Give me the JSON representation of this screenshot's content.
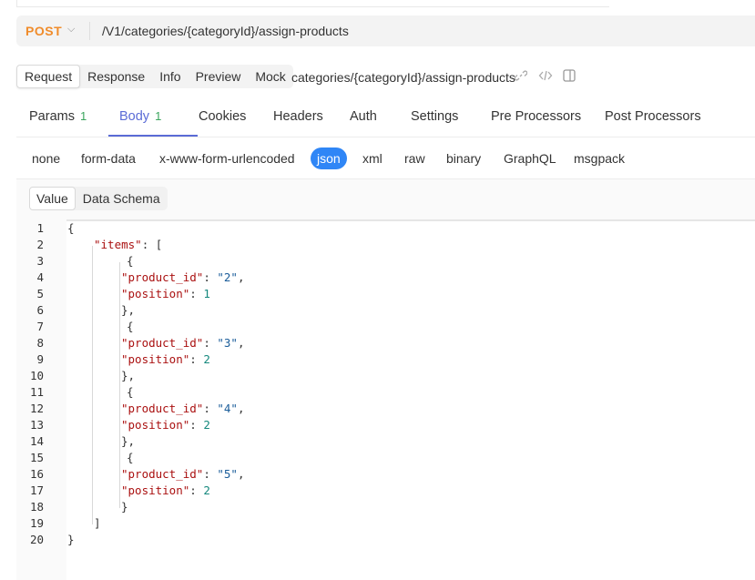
{
  "request": {
    "method": "POST",
    "url": "/V1/categories/{categoryId}/assign-products"
  },
  "subtabs": [
    "Request",
    "Response",
    "Info",
    "Preview",
    "Mock"
  ],
  "endpoint_name": "categories/{categoryId}/assign-products",
  "main_tabs": [
    {
      "label": "Params",
      "count": "1"
    },
    {
      "label": "Body",
      "count": "1"
    },
    {
      "label": "Cookies",
      "count": ""
    },
    {
      "label": "Headers",
      "count": ""
    },
    {
      "label": "Auth",
      "count": ""
    },
    {
      "label": "Settings",
      "count": ""
    },
    {
      "label": "Pre Processors",
      "count": ""
    },
    {
      "label": "Post Processors",
      "count": ""
    }
  ],
  "body_types": [
    "none",
    "form-data",
    "x-www-form-urlencoded",
    "json",
    "xml",
    "raw",
    "binary",
    "GraphQL",
    "msgpack"
  ],
  "value_tabs": [
    "Value",
    "Data Schema"
  ],
  "code": {
    "line_numbers": [
      "1",
      "2",
      "3",
      "4",
      "5",
      "6",
      "7",
      "8",
      "9",
      "10",
      "11",
      "12",
      "13",
      "14",
      "15",
      "16",
      "17",
      "18",
      "19",
      "20"
    ],
    "items_key": "\"items\"",
    "key_product_id": "\"product_id\"",
    "key_position": "\"position\"",
    "values": [
      {
        "product_id": "\"2\"",
        "position": "1"
      },
      {
        "product_id": "\"3\"",
        "position": "2"
      },
      {
        "product_id": "\"4\"",
        "position": "2"
      },
      {
        "product_id": "\"5\"",
        "position": "2"
      }
    ]
  },
  "colors": {
    "method": "#f08c2b",
    "active_tab": "#5a6bd6",
    "count": "#3aa55d",
    "json_pill": "#2f86f6"
  }
}
